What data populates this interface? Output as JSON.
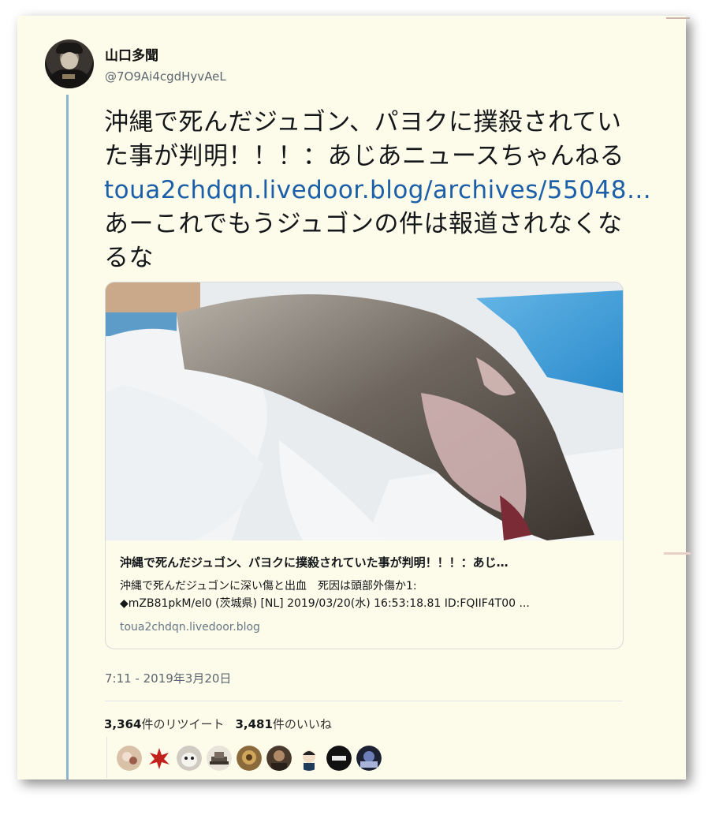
{
  "user": {
    "name": "山口多聞",
    "handle": "@7O9Ai4cgdHyvAeL"
  },
  "tweet": {
    "text_before_link": "沖縄で死んだジュゴン、パヨクに撲殺されていた事が判明！！！：あじあニュースちゃんねる ",
    "link_text": "toua2chdqn.livedoor.blog/archives/55048…",
    "text_after_link": "　あーこれでもうジュゴンの件は報道されなくなるな"
  },
  "link_card": {
    "title": "沖縄で死んだジュゴン、パヨクに撲殺されていた事が判明！！！：あじ…",
    "description_line1": "沖縄で死んだジュゴンに深い傷と出血　死因は頭部外傷か1:",
    "description_line2": "◆mZB81pkM/el0 (茨城県) [NL] 2019/03/20(水) 16:53:18.81 ID:FQIIF4T00 ...",
    "domain": "toua2chdqn.livedoor.blog"
  },
  "timestamp": "7:11 - 2019年3月20日",
  "stats": {
    "retweets_count": "3,364",
    "retweets_label": "件のリツイート",
    "likes_count": "3,481",
    "likes_label": "件のいいね"
  },
  "colors": {
    "background": "#fdfbe9",
    "link": "#1b5fa8",
    "thread_line": "#8fb3cf"
  },
  "liker_avatars": [
    {
      "icon": "avatar-1"
    },
    {
      "icon": "avatar-2"
    },
    {
      "icon": "avatar-3"
    },
    {
      "icon": "avatar-4"
    },
    {
      "icon": "avatar-5"
    },
    {
      "icon": "avatar-6"
    },
    {
      "icon": "avatar-7"
    },
    {
      "icon": "avatar-8"
    },
    {
      "icon": "avatar-9"
    }
  ]
}
